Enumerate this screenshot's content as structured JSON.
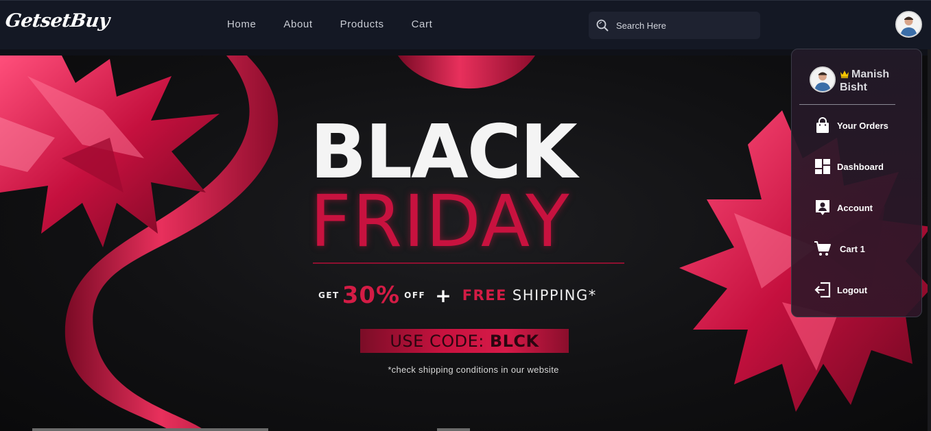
{
  "brand": {
    "logo_text": "GetsetBuy"
  },
  "nav": {
    "links": [
      {
        "label": "Home"
      },
      {
        "label": "About"
      },
      {
        "label": "Products"
      },
      {
        "label": "Cart"
      }
    ]
  },
  "search": {
    "placeholder": "Search Here",
    "value": ""
  },
  "hero": {
    "line1": "BLACK",
    "line2": "FRIDAY",
    "offer_get": "GET",
    "offer_percent": "30%",
    "offer_off": "OFF",
    "offer_plus": "+",
    "offer_free": "FREE",
    "offer_shipping": "SHIPPING*",
    "code_label": "USE CODE:",
    "code_value": "BLCK",
    "fineprint": "*check shipping conditions in our website"
  },
  "user_menu": {
    "user_name": "Manish Bisht",
    "items": [
      {
        "label": "Your Orders",
        "icon": "shopping-bag-icon"
      },
      {
        "label": "Dashboard",
        "icon": "dashboard-icon"
      },
      {
        "label": "Account",
        "icon": "account-icon"
      },
      {
        "label": "Cart 1",
        "icon": "cart-icon"
      },
      {
        "label": "Logout",
        "icon": "logout-icon"
      }
    ]
  },
  "colors": {
    "nav_bg": "#141824",
    "accent": "#c8123f",
    "crown": "#f5c400"
  }
}
